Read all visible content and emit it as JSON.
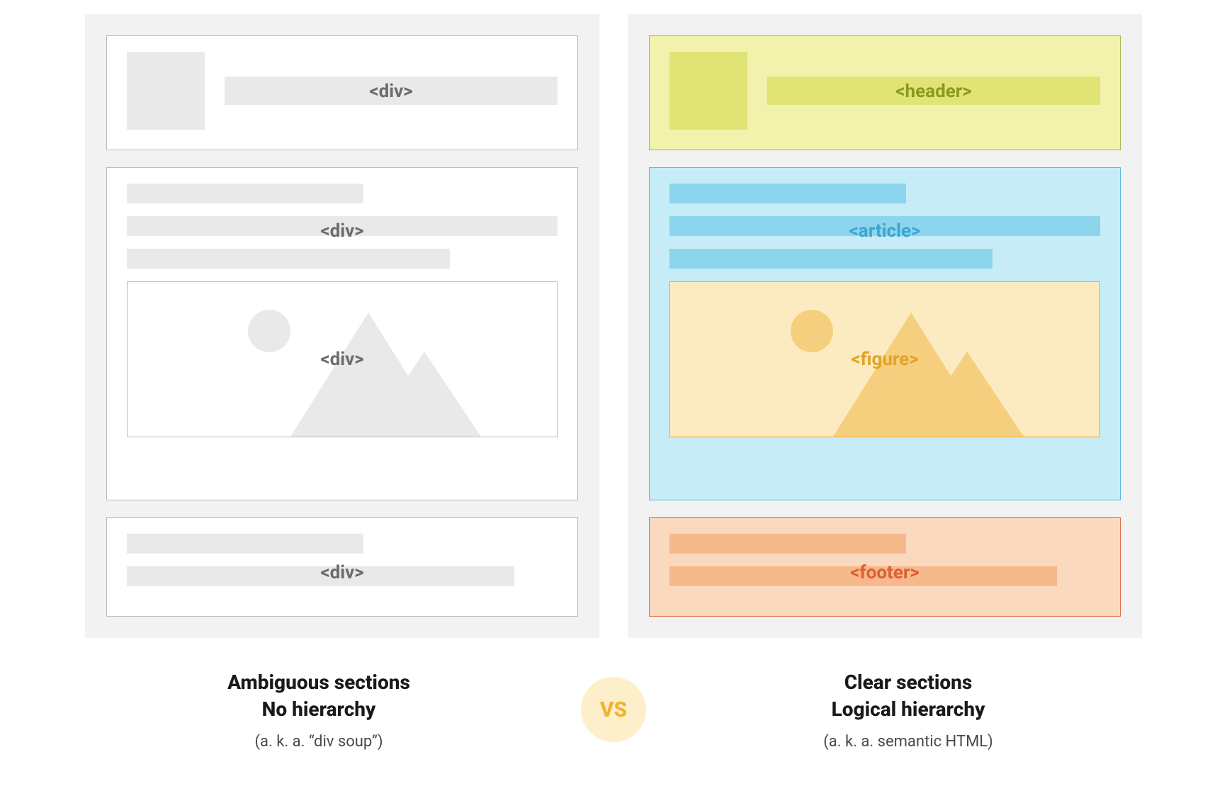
{
  "left": {
    "labels": {
      "header": "<div>",
      "content": "<div>",
      "figure": "<div>",
      "footer": "<div>"
    },
    "caption_title_line1": "Ambiguous sections",
    "caption_title_line2": "No hierarchy",
    "caption_sub": "(a. k. a. “div soup”)"
  },
  "right": {
    "labels": {
      "header": "<header>",
      "article": "<article>",
      "figure": "<figure>",
      "footer": "<footer>"
    },
    "caption_title_line1": "Clear sections",
    "caption_title_line2": "Logical hierarchy",
    "caption_sub": "(a. k. a. semantic HTML)"
  },
  "vs_label": "VS"
}
